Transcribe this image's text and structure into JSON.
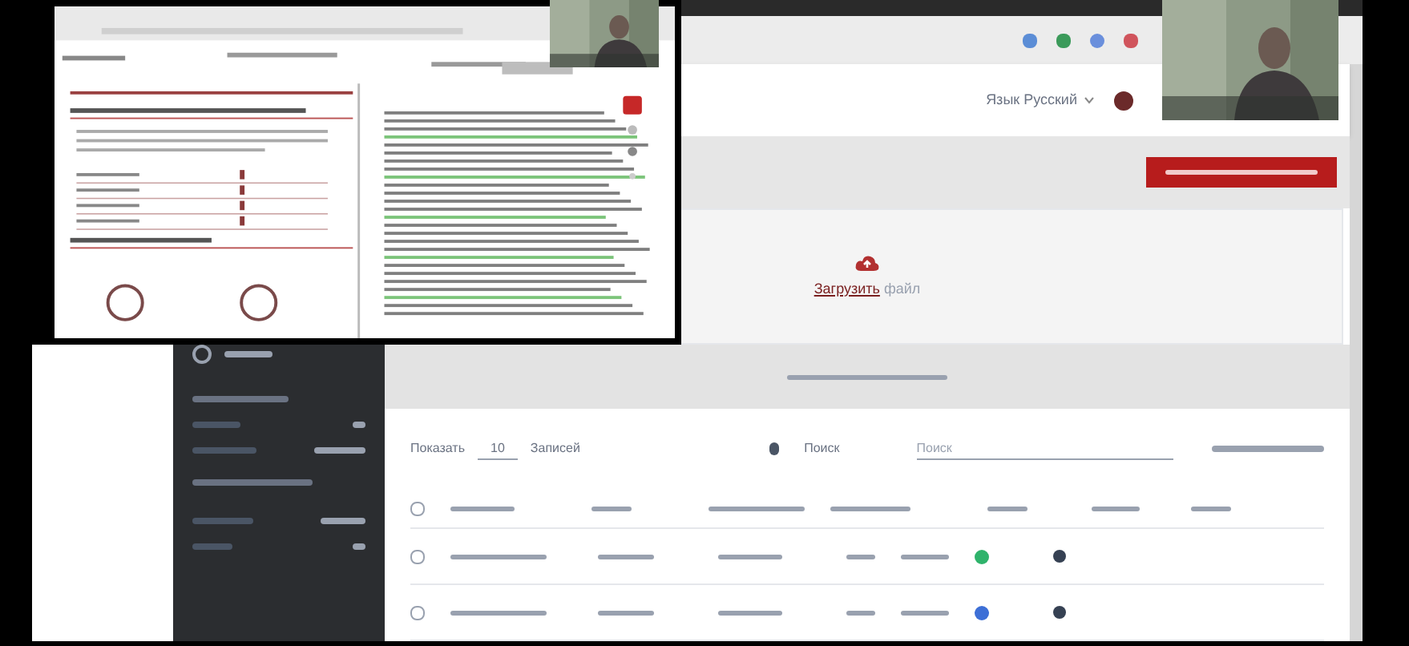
{
  "header": {
    "language": "Язык Русский"
  },
  "upload": {
    "link": "Загрузить",
    "text": "файл"
  },
  "table": {
    "show_label": "Показать",
    "page_size": "10",
    "entries_label": "Записей",
    "search_label": "Поиск",
    "search_placeholder": "Поиск",
    "header_checked": false,
    "rows": [
      {
        "color": "#2fb36b",
        "checked": false
      },
      {
        "color": "#3d6fd6",
        "checked": false
      }
    ]
  }
}
